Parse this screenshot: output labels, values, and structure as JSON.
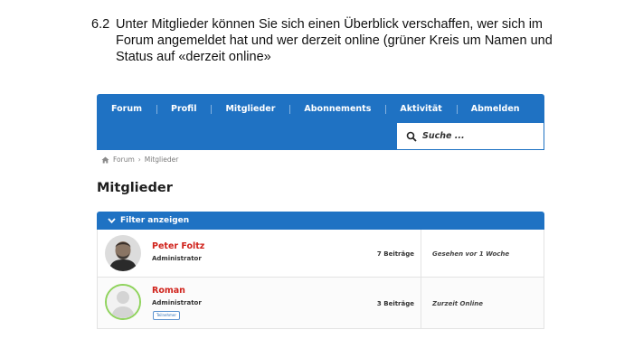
{
  "instruction": {
    "number": "6.2",
    "lines": [
      "Unter Mitglieder können Sie sich einen Überblick verschaffen, wer sich im",
      "Forum angemeldet hat und wer derzeit online (grüner Kreis um Namen und",
      "Status auf «derzeit online»"
    ]
  },
  "navbar": {
    "items": [
      "Forum",
      "Profil",
      "Mitglieder",
      "Abonnements",
      "Aktivität",
      "Abmelden"
    ],
    "accent_color": "#1f72c3"
  },
  "search": {
    "placeholder": "Suche ..."
  },
  "breadcrumb": {
    "home": "Forum",
    "separator": "›",
    "current": "Mitglieder"
  },
  "page_title": "Mitglieder",
  "filter": {
    "label": "Filter anzeigen"
  },
  "members": [
    {
      "name": "Peter Foltz",
      "role": "Administrator",
      "badge": "",
      "posts": "7 Beiträge",
      "status": "Gesehen vor 1 Woche",
      "online": false
    },
    {
      "name": "Roman",
      "role": "Administrator",
      "badge": "Teilnehmer",
      "posts": "3 Beiträge",
      "status": "Zurzeit Online",
      "online": true,
      "online_ring_color": "#8fd35c"
    }
  ]
}
